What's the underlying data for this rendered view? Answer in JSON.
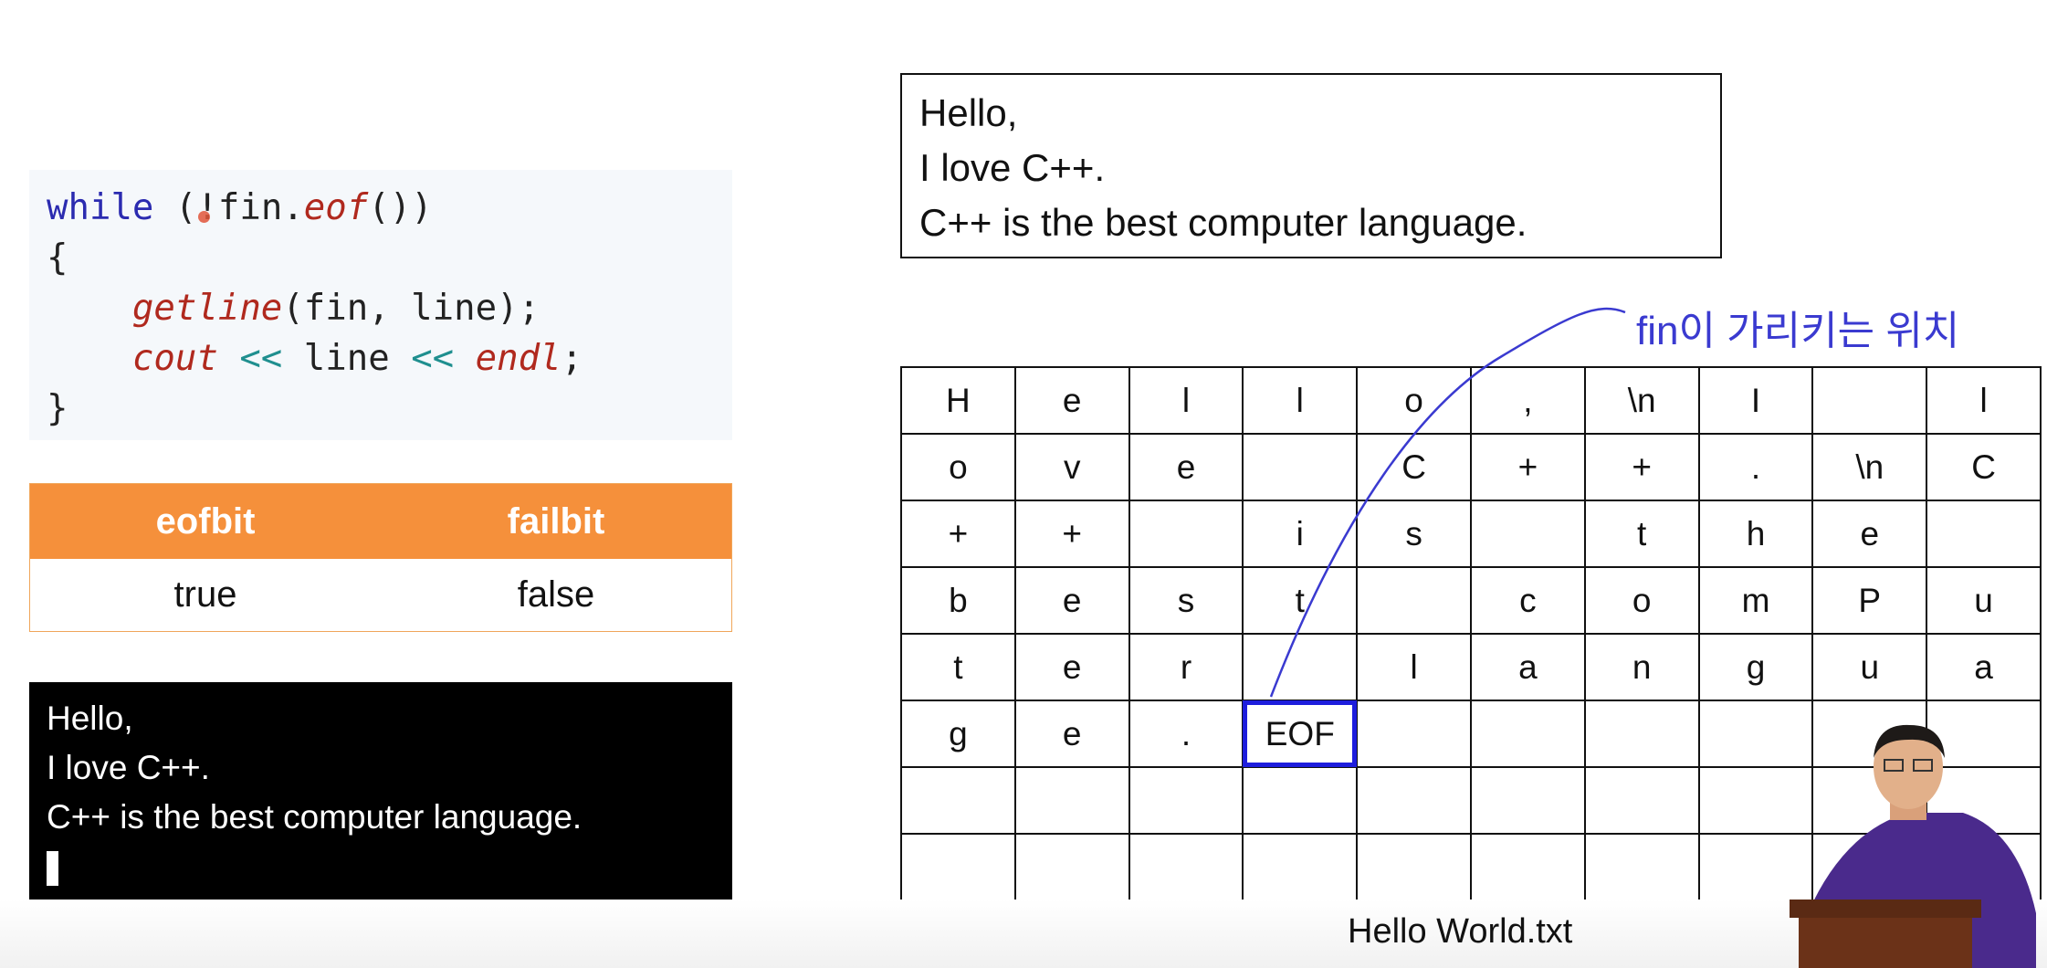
{
  "code": {
    "lines": [
      [
        {
          "t": "while",
          "c": "kw"
        },
        {
          "t": " (",
          "c": "pl"
        },
        {
          "t": "!",
          "c": "pl"
        },
        {
          "t": "fin.",
          "c": "pl"
        },
        {
          "t": "eof",
          "c": "fn"
        },
        {
          "t": "())",
          "c": "pl"
        }
      ],
      [
        {
          "t": "{",
          "c": "pl"
        }
      ],
      [
        {
          "t": "    ",
          "c": "pl"
        },
        {
          "t": "getline",
          "c": "fn"
        },
        {
          "t": "(fin, line);",
          "c": "pl"
        }
      ],
      [
        {
          "t": "    ",
          "c": "pl"
        },
        {
          "t": "cout",
          "c": "fn"
        },
        {
          "t": " ",
          "c": "pl"
        },
        {
          "t": "<<",
          "c": "op"
        },
        {
          "t": " line ",
          "c": "pl"
        },
        {
          "t": "<<",
          "c": "op"
        },
        {
          "t": " ",
          "c": "pl"
        },
        {
          "t": "endl",
          "c": "fn"
        },
        {
          "t": ";",
          "c": "pl"
        }
      ],
      [
        {
          "t": "}",
          "c": "pl"
        }
      ]
    ]
  },
  "flags": {
    "headers": [
      "eofbit",
      "failbit"
    ],
    "values": [
      "true",
      "false"
    ]
  },
  "console": {
    "lines": [
      "Hello,",
      "I love C++.",
      "C++ is the best computer language."
    ]
  },
  "file_text": {
    "lines": [
      "Hello,",
      "I love C++.",
      "C++ is the best computer language."
    ]
  },
  "grid": {
    "rows": [
      [
        "H",
        "e",
        "l",
        "l",
        "o",
        ",",
        "\\n",
        "I",
        "",
        "l"
      ],
      [
        "o",
        "v",
        "e",
        "",
        "C",
        "+",
        "+",
        ".",
        "\\n",
        "C"
      ],
      [
        "+",
        "+",
        "",
        "i",
        "s",
        "",
        "t",
        "h",
        "e",
        ""
      ],
      [
        "b",
        "e",
        "s",
        "t",
        "",
        "c",
        "o",
        "m",
        "P",
        "u"
      ],
      [
        "t",
        "e",
        "r",
        "",
        "l",
        "a",
        "n",
        "g",
        "u",
        "a"
      ],
      [
        "g",
        "e",
        ".",
        "EOF",
        "",
        "",
        "",
        "",
        "",
        ""
      ],
      [
        "",
        "",
        "",
        "",
        "",
        "",
        "",
        "",
        "",
        ""
      ],
      [
        "",
        "",
        "",
        "",
        "",
        "",
        "",
        "",
        "",
        ""
      ]
    ],
    "highlight_cell": {
      "row": 5,
      "col": 3
    }
  },
  "annotation": {
    "label": "fin이 가리키는 위치",
    "color": "#3a3ad0"
  },
  "caption": "Hello World.txt",
  "colors": {
    "header_orange": "#f5903b",
    "highlight_blue": "#1d1ddd",
    "keyword_blue": "#2b2bb0",
    "function_red": "#b0291e",
    "operator_teal": "#1f8f8f"
  }
}
